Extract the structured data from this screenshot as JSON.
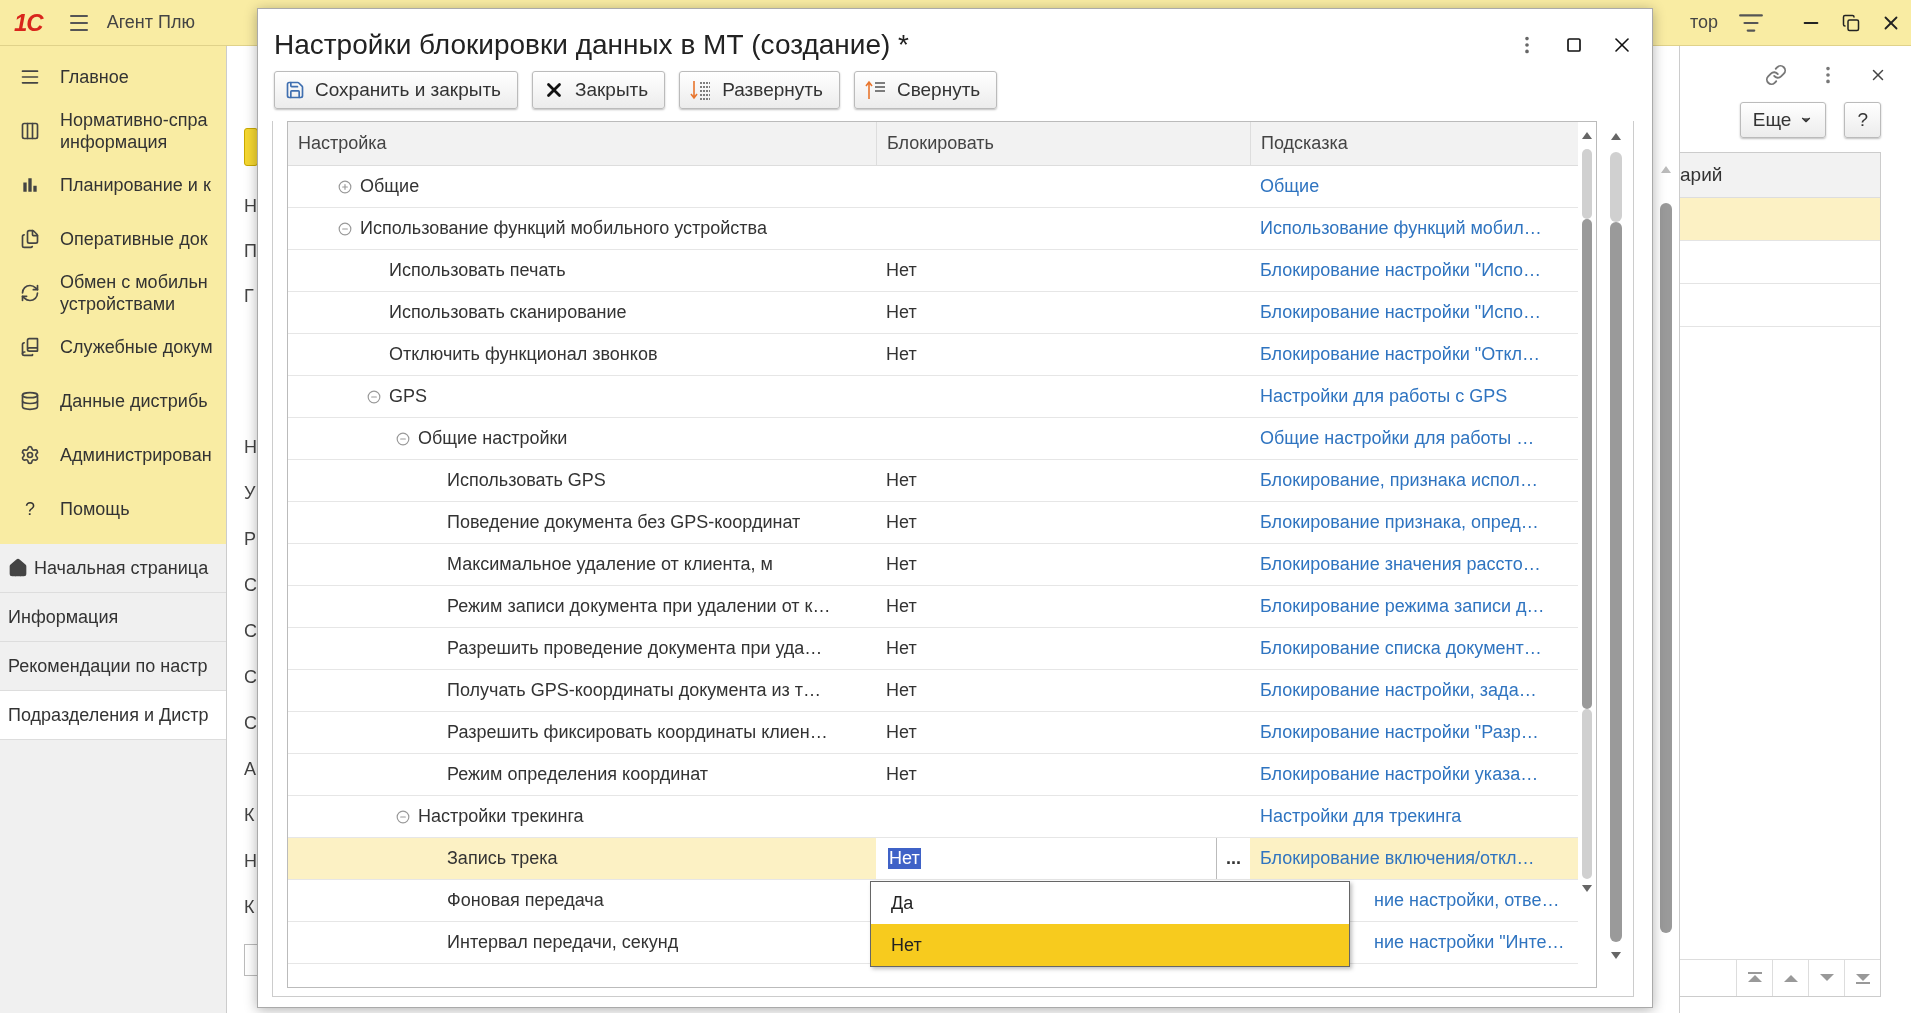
{
  "app": {
    "logo": "1С",
    "title": "Агент Плю"
  },
  "sidebar": {
    "sections": [
      {
        "label": "Главное"
      },
      {
        "label": "Нормативно-спра\nинформация"
      },
      {
        "label": "Планирование и к"
      },
      {
        "label": "Оперативные док"
      },
      {
        "label": "Обмен с мобильн\nустройствами"
      },
      {
        "label": "Служебные докум"
      },
      {
        "label": "Данные дистрибь"
      },
      {
        "label": "Администрирован"
      },
      {
        "label": "Помощь",
        "glyph": "?"
      }
    ],
    "open_pages": [
      {
        "label": "Начальная страница",
        "kind": "home",
        "selected": false
      },
      {
        "label": "Информация",
        "kind": "page",
        "selected": false
      },
      {
        "label": "Рекомендации по настр",
        "kind": "page",
        "selected": false
      },
      {
        "label": "Подразделения и Дистр",
        "kind": "page",
        "selected": true
      }
    ]
  },
  "background_form": {
    "labels_top": [
      "Н",
      "П",
      "Г"
    ],
    "labels_bottom": [
      "Н",
      "У",
      "Р",
      "С",
      "С",
      "С",
      "С",
      "А",
      "К",
      "Н",
      "К"
    ]
  },
  "dialog": {
    "title": "Настройки блокировки данных в МТ (создание) *",
    "toolbar": [
      {
        "label": "Сохранить и закрыть",
        "kind": "save"
      },
      {
        "label": "Закрыть",
        "kind": "close"
      },
      {
        "label": "Развернуть",
        "kind": "expand"
      },
      {
        "label": "Свернуть",
        "kind": "collapse"
      }
    ],
    "table": {
      "columns": [
        "Настройка",
        "Блокировать",
        "Подсказка"
      ],
      "rows": [
        {
          "name": "Общие",
          "hint": "Общие",
          "expanded": false,
          "selected": false
        },
        {
          "name": "Использование функций мобильного устройства",
          "hint": "Использование функций мобил…",
          "expanded": true,
          "selected": false,
          "children": [
            {
              "name": "Использовать печать",
              "block": "Нет",
              "hint": "Блокирование настройки \"Испо…",
              "selected": false
            },
            {
              "name": "Использовать сканирование",
              "block": "Нет",
              "hint": "Блокирование настройки \"Испо…",
              "selected": false
            },
            {
              "name": "Отключить функционал звонков",
              "block": "Нет",
              "hint": "Блокирование настройки \"Откл…",
              "selected": false
            },
            {
              "name": "GPS",
              "hint": "Настройки для работы с GPS",
              "expanded": true,
              "selected": false,
              "children": [
                {
                  "name": "Общие настройки",
                  "hint": "Общие настройки для работы …",
                  "expanded": true,
                  "selected": false,
                  "children": [
                    {
                      "name": "Использовать GPS",
                      "block": "Нет",
                      "hint": "Блокирование, признака испол…",
                      "selected": false
                    },
                    {
                      "name": "Поведение документа без GPS-координат",
                      "block": "Нет",
                      "hint": "Блокирование признака, опред…",
                      "selected": false
                    },
                    {
                      "name": "Максимальное удаление от клиента, м",
                      "block": "Нет",
                      "hint": "Блокирование значения рассто…",
                      "selected": false
                    },
                    {
                      "name": "Режим записи документа при удалении от к…",
                      "block": "Нет",
                      "hint": "Блокирование режима записи д…",
                      "selected": false
                    },
                    {
                      "name": "Разрешить проведение документа при уда…",
                      "block": "Нет",
                      "hint": "Блокирование списка документ…",
                      "selected": false
                    },
                    {
                      "name": "Получать GPS-координаты документа из т…",
                      "block": "Нет",
                      "hint": "Блокирование настройки, зада…",
                      "selected": false
                    },
                    {
                      "name": "Разрешить фиксировать координаты клиен…",
                      "block": "Нет",
                      "hint": "Блокирование настройки \"Разр…",
                      "selected": false
                    },
                    {
                      "name": "Режим определения координат",
                      "block": "Нет",
                      "hint": "Блокирование настройки указа…",
                      "selected": false
                    }
                  ]
                },
                {
                  "name": "Настройки трекинга",
                  "hint": "Настройки для трекинга",
                  "expanded": true,
                  "selected": false,
                  "children": [
                    {
                      "name": "Запись трека",
                      "block": "Нет",
                      "hint": "Блокирование включения/откл…",
                      "selected": true,
                      "choice_button": "..."
                    },
                    {
                      "name": "Фоновая передача",
                      "hint": "ние настройки, отве…",
                      "selected": false
                    },
                    {
                      "name": "Интервал передачи, секунд",
                      "hint": "ние настройки \"Инте…",
                      "selected": false
                    }
                  ]
                }
              ]
            }
          ]
        }
      ]
    },
    "dropdown": {
      "options": [
        {
          "label": "Да",
          "selected": false
        },
        {
          "label": "Нет",
          "selected": true
        }
      ]
    }
  },
  "right_panel": {
    "title_fragment": "тор",
    "buttons": [
      {
        "label": "Еще",
        "kind": "menu"
      },
      {
        "label": "?",
        "kind": "plain"
      }
    ],
    "table": {
      "column_1": "арий",
      "rows": [
        {
          "selected": true
        },
        {
          "selected": false
        },
        {
          "selected": false
        }
      ]
    }
  }
}
